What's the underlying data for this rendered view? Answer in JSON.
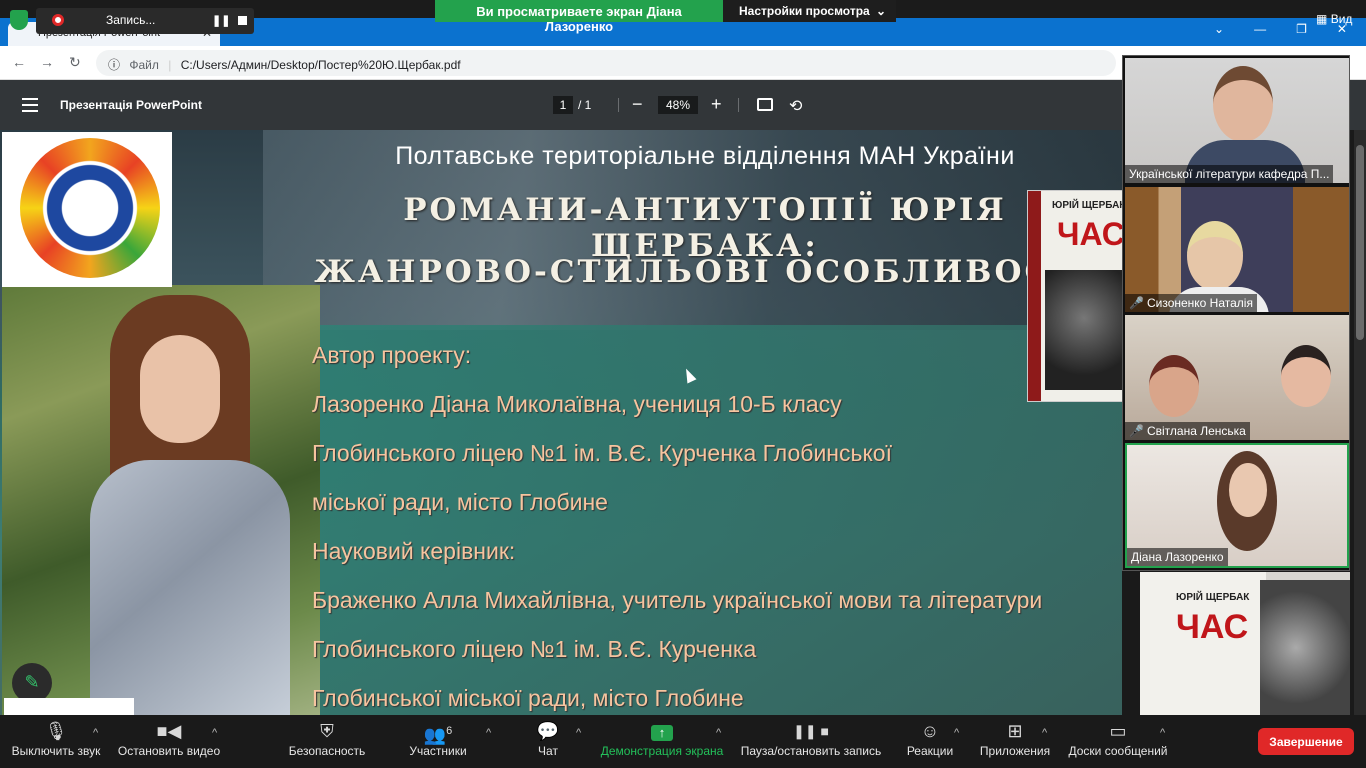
{
  "zoom_share": {
    "banner": "Ви просматриваете экран Діана Лазоренко",
    "settings": "Настройки просмотра",
    "recording": "Запись...",
    "view": "Вид"
  },
  "browser": {
    "tab_title": "Презентація PowerPoint",
    "url_scheme": "Файл",
    "url": "C:/Users/Админ/Desktop/Постер%20Ю.Щербак.pdf"
  },
  "pdf_toolbar": {
    "title": "Презентація PowerPoint",
    "page_current": "1",
    "page_total": "/ 1",
    "zoom": "48%"
  },
  "slide": {
    "title1": "Полтавське територіальне відділення МАН України",
    "title2": "РОМАНИ-АНТИУТОПІЇ ЮРІЯ ЩЕРБАКА:",
    "title3": "ЖАНРОВО-СТИЛЬОВІ ОСОБЛИВОСТІ",
    "lines": [
      "Автор проекту:",
      "Лазоренко Діана Миколаївна, учениця 10-Б класу",
      "Глобинського ліцею №1 ім. В.Є. Курченка Глобинської",
      "міської ради, місто Глобине",
      "Науковий керівник:",
      "Браженко Алла Михайлівна, учитель української мови та літератури",
      "Глобинського ліцею №1 ім. В.Є. Курченка",
      "Глобинської міської ради, місто Глобине"
    ],
    "book1_author": "ЮРІЙ ЩЕРБАК",
    "book1_title": "ЧАС",
    "book2_author": "ЮРІЙ ЩЕРБАК",
    "book2_title": "ЧАС"
  },
  "participants": [
    {
      "name": "Української літератури кафедра П...",
      "muted": false
    },
    {
      "name": "Сизоненко Наталія",
      "muted": true
    },
    {
      "name": "Світлана Ленська",
      "muted": true
    },
    {
      "name": "Діана Лазоренко",
      "muted": false
    }
  ],
  "controls": {
    "mute": "Выключить звук",
    "video": "Остановить видео",
    "security": "Безопасность",
    "participants": "Участники",
    "participants_count": "6",
    "chat": "Чат",
    "share": "Демонстрация экрана",
    "record": "Пауза/остановить запись",
    "reactions": "Реакции",
    "apps": "Приложения",
    "whiteboards": "Доски сообщений",
    "end": "Завершение"
  },
  "colors": {
    "zoom_green": "#23a24d",
    "end_red": "#e02828",
    "chrome_blue": "#0b72cf",
    "slide_text": "#f6c49f"
  }
}
